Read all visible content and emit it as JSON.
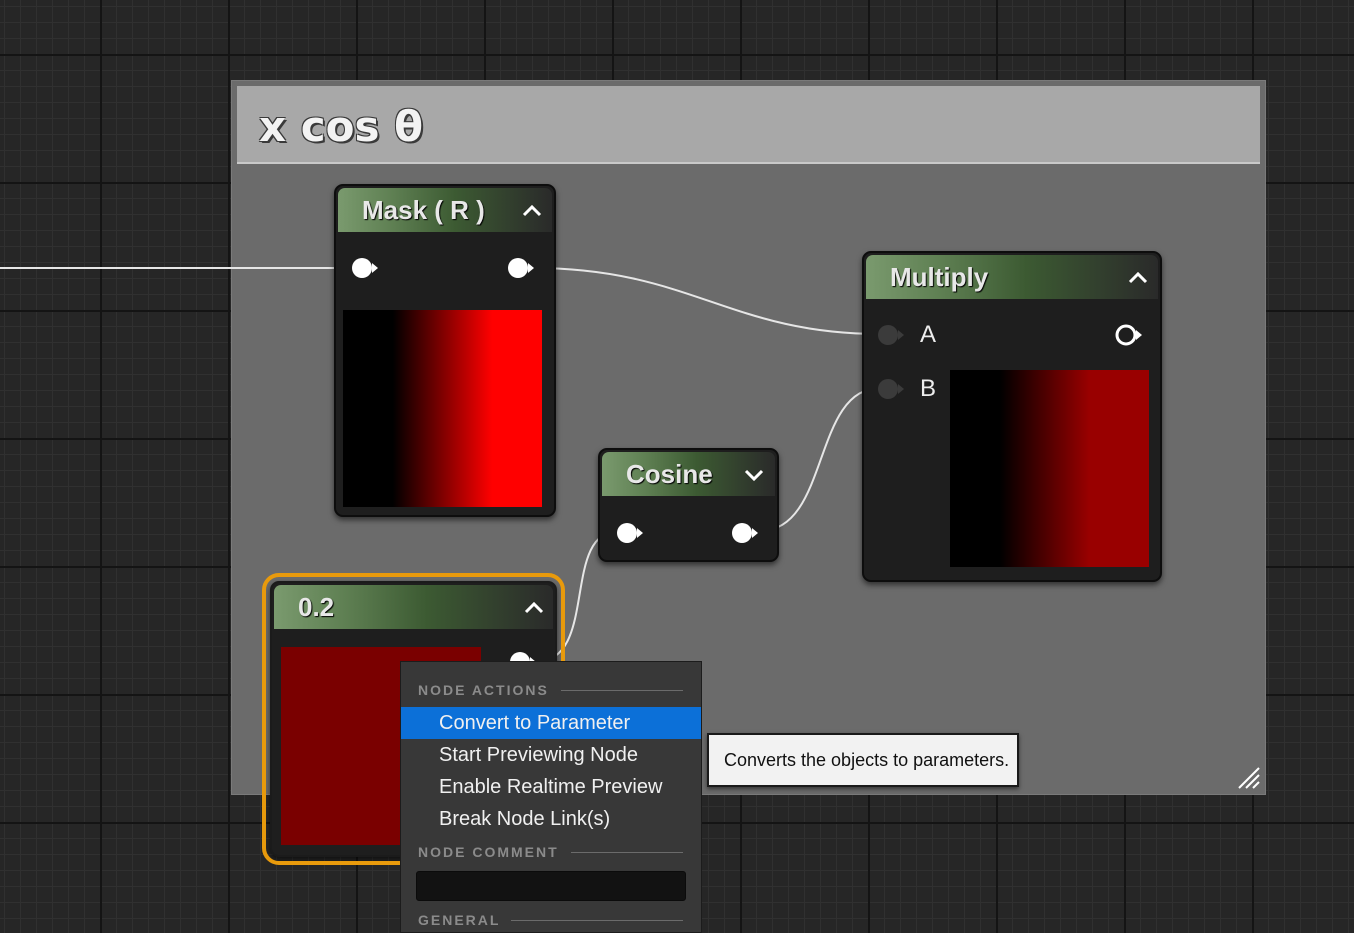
{
  "comment": {
    "title": "x cos θ"
  },
  "nodes": {
    "mask": {
      "title": "Mask ( R )"
    },
    "multiply": {
      "title": "Multiply",
      "pin_a": "A",
      "pin_b": "B"
    },
    "cosine": {
      "title": "Cosine"
    },
    "constant": {
      "title": "0.2"
    }
  },
  "context_menu": {
    "section_node_actions": "NODE ACTIONS",
    "items": [
      "Convert to Parameter",
      "Start Previewing Node",
      "Enable Realtime Preview",
      "Break Node Link(s)"
    ],
    "highlighted_item": "Convert to Parameter",
    "section_node_comment": "NODE COMMENT",
    "comment_value": "",
    "section_general": "GENERAL"
  },
  "tooltip": {
    "text": "Converts the objects to parameters."
  },
  "icons": {
    "pin": "exec-pin-icon",
    "collapse": "chevron-up-icon",
    "expand": "chevron-down-icon",
    "resize": "resize-grip-icon"
  },
  "colors": {
    "node_header_accent": "#5f8053",
    "selection_outline": "#e89a0c",
    "menu_highlight": "#0c70d8",
    "mask_preview_red": "#ff0000",
    "multiply_preview_red": "#990000",
    "constant_preview_red": "#7a0000"
  }
}
